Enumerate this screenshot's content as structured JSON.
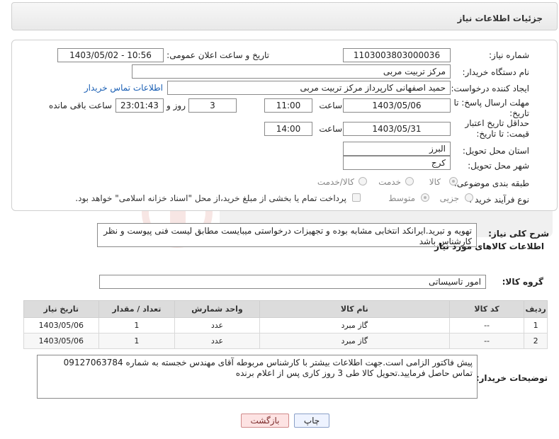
{
  "header": {
    "title": "جزئیات اطلاعات نیاز"
  },
  "form": {
    "need_number": {
      "label": "شماره نیاز:",
      "value": "1103003803000036"
    },
    "announce_datetime": {
      "label": "تاریخ و ساعت اعلان عمومی:",
      "value": "1403/05/02 - 10:56"
    },
    "buyer_org": {
      "label": "نام دستگاه خریدار:",
      "value": "مرکز تربیت مربی"
    },
    "requester": {
      "label": "ایجاد کننده درخواست:",
      "value": "حمید اصفهانی کارپرداز مرکز تربیت مربی",
      "contact_link": "اطلاعات تماس خریدار"
    },
    "reply_deadline": {
      "label": "مهلت ارسال پاسخ: تا تاریخ:",
      "date": "1403/05/06",
      "time_label": "ساعت",
      "time": "11:00",
      "days": "3",
      "days_label": "روز و",
      "remaining": "23:01:43",
      "remaining_label": "ساعت باقی مانده"
    },
    "price_validity": {
      "label": "حداقل تاریخ اعتبار قیمت: تا تاریخ:",
      "date": "1403/05/31",
      "time_label": "ساعت",
      "time": "14:00"
    },
    "province": {
      "label": "استان محل تحویل:",
      "value": "البرز"
    },
    "city": {
      "label": "شهر محل تحویل:",
      "value": "کرج"
    },
    "category": {
      "label": "طبقه بندی موضوعی:",
      "options": [
        "کالا",
        "خدمت",
        "کالا/خدمت"
      ],
      "selected": "کالا"
    },
    "purchase_type": {
      "label": "نوع فرآیند خرید :",
      "options": [
        "جزیی",
        "متوسط"
      ],
      "selected": "متوسط",
      "payment_note": "پرداخت تمام یا بخشی از مبلغ خرید،از محل \"اسناد خزانه اسلامی\" خواهد بود."
    }
  },
  "description": {
    "label": "شرح کلی نیاز:",
    "text": "تهویه و تبرید.ایرانکد انتخابی مشابه بوده و تجهیزات درخواستی میبایست مطابق لیست فنی پیوست و نظر کارشناس باشد"
  },
  "goods_section": {
    "title": "اطلاعات کالاهای مورد نیاز",
    "group_label": "گروه کالا:",
    "group_value": "امور تاسیساتی"
  },
  "items_table": {
    "headers": [
      "ردیف",
      "کد کالا",
      "نام کالا",
      "واحد شمارش",
      "تعداد / مقدار",
      "تاریخ نیاز"
    ],
    "rows": [
      [
        "1",
        "--",
        "گاز مبرد",
        "عدد",
        "1",
        "1403/05/06"
      ],
      [
        "2",
        "--",
        "گاز مبرد",
        "عدد",
        "1",
        "1403/05/06"
      ]
    ]
  },
  "buyer_notes": {
    "label": "توضیحات خریدار:",
    "text": "پیش فاکتور الزامی است.جهت اطلاعات بیشتر با کارشناس مربوطه آقای مهندس خجسته به شماره 09127063784 تماس حاصل فرمایید.تحویل کالا طی 3 روز کاری پس از اعلام برنده"
  },
  "buttons": {
    "print": "چاپ",
    "back": "بازگشت"
  },
  "colors": {
    "link": "#1a5fb4",
    "back_button_bg": "#fde3e3",
    "print_button_bg": "#eef3ff"
  }
}
